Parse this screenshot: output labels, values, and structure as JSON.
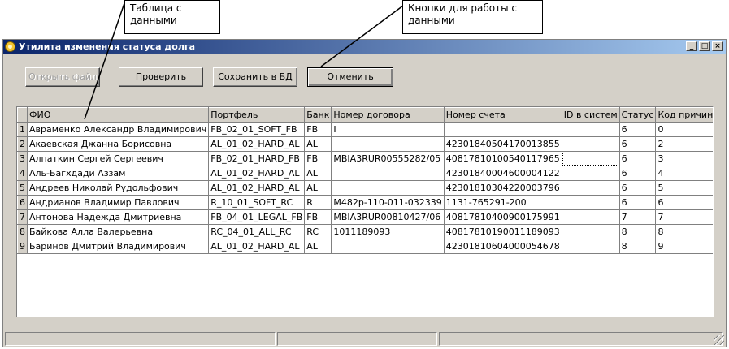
{
  "callouts": {
    "table": "Таблица с данными",
    "buttons": "Кнопки для работы с данными"
  },
  "window": {
    "title": "Утилита изменения статуса долга"
  },
  "toolbar": {
    "open_label": "Открыть файл",
    "check_label": "Проверить",
    "save_label": "Сохранить в БД",
    "cancel_label": "Отменить"
  },
  "grid": {
    "columns": [
      "ФИО",
      "Портфель",
      "Банк",
      "Номер договора",
      "Номер счета",
      "ID в систем",
      "Статус",
      "Код причины"
    ],
    "rows": [
      {
        "n": "1",
        "fio": "Авраменко Александр Владимирович",
        "portfolio": "FB_02_01_SOFT_FB",
        "bank": "FB",
        "contract": "I",
        "account": "",
        "id": "",
        "status": "6",
        "reason": "0"
      },
      {
        "n": "2",
        "fio": "Акаевская Джанна Борисовна",
        "portfolio": "AL_01_02_HARD_AL",
        "bank": "AL",
        "contract": "",
        "account": "42301840504170013855",
        "id": "",
        "status": "6",
        "reason": "2"
      },
      {
        "n": "3",
        "fio": "Алпаткин Сергей Сергеевич",
        "portfolio": "FB_02_01_HARD_FB",
        "bank": "FB",
        "contract": "MBIA3RUR00555282/05",
        "account": "40817810100540117965",
        "id": "",
        "status": "6",
        "reason": "3"
      },
      {
        "n": "4",
        "fio": "Аль-Багхдади Аззам",
        "portfolio": "AL_01_02_HARD_AL",
        "bank": "AL",
        "contract": "",
        "account": "42301840004600004122",
        "id": "",
        "status": "6",
        "reason": "4"
      },
      {
        "n": "5",
        "fio": "Андреев Николай Рудольфович",
        "portfolio": "AL_01_02_HARD_AL",
        "bank": "AL",
        "contract": "",
        "account": "42301810304220003796",
        "id": "",
        "status": "6",
        "reason": "5"
      },
      {
        "n": "6",
        "fio": "Андрианов Владимир Павлович",
        "portfolio": "R_10_01_SOFT_RC",
        "bank": "R",
        "contract": "M482p-110-011-032339",
        "account": "1131-765291-200",
        "id": "",
        "status": "6",
        "reason": "6"
      },
      {
        "n": "7",
        "fio": "Антонова Надежда Дмитриевна",
        "portfolio": "FB_04_01_LEGAL_FB",
        "bank": "FB",
        "contract": "MBIA3RUR00810427/06",
        "account": "40817810400900175991",
        "id": "",
        "status": "7",
        "reason": "7"
      },
      {
        "n": "8",
        "fio": "Байкова Алла Валерьевна",
        "portfolio": "RC_04_01_ALL_RC",
        "bank": "RC",
        "contract": "1011189093",
        "account": "40817810190011189093",
        "id": "",
        "status": "8",
        "reason": "8"
      },
      {
        "n": "9",
        "fio": "Баринов Дмитрий Владимирович",
        "portfolio": "AL_01_02_HARD_AL",
        "bank": "AL",
        "contract": "",
        "account": "42301810604000054678",
        "id": "",
        "status": "8",
        "reason": "9"
      }
    ]
  },
  "colors": {
    "window_bg": "#d4d0c8",
    "title_start": "#0a246a",
    "title_end": "#a6caf0"
  },
  "icons": {
    "app": "app-icon",
    "minimize": "minimize-icon",
    "maximize": "maximize-icon",
    "close": "close-icon"
  }
}
